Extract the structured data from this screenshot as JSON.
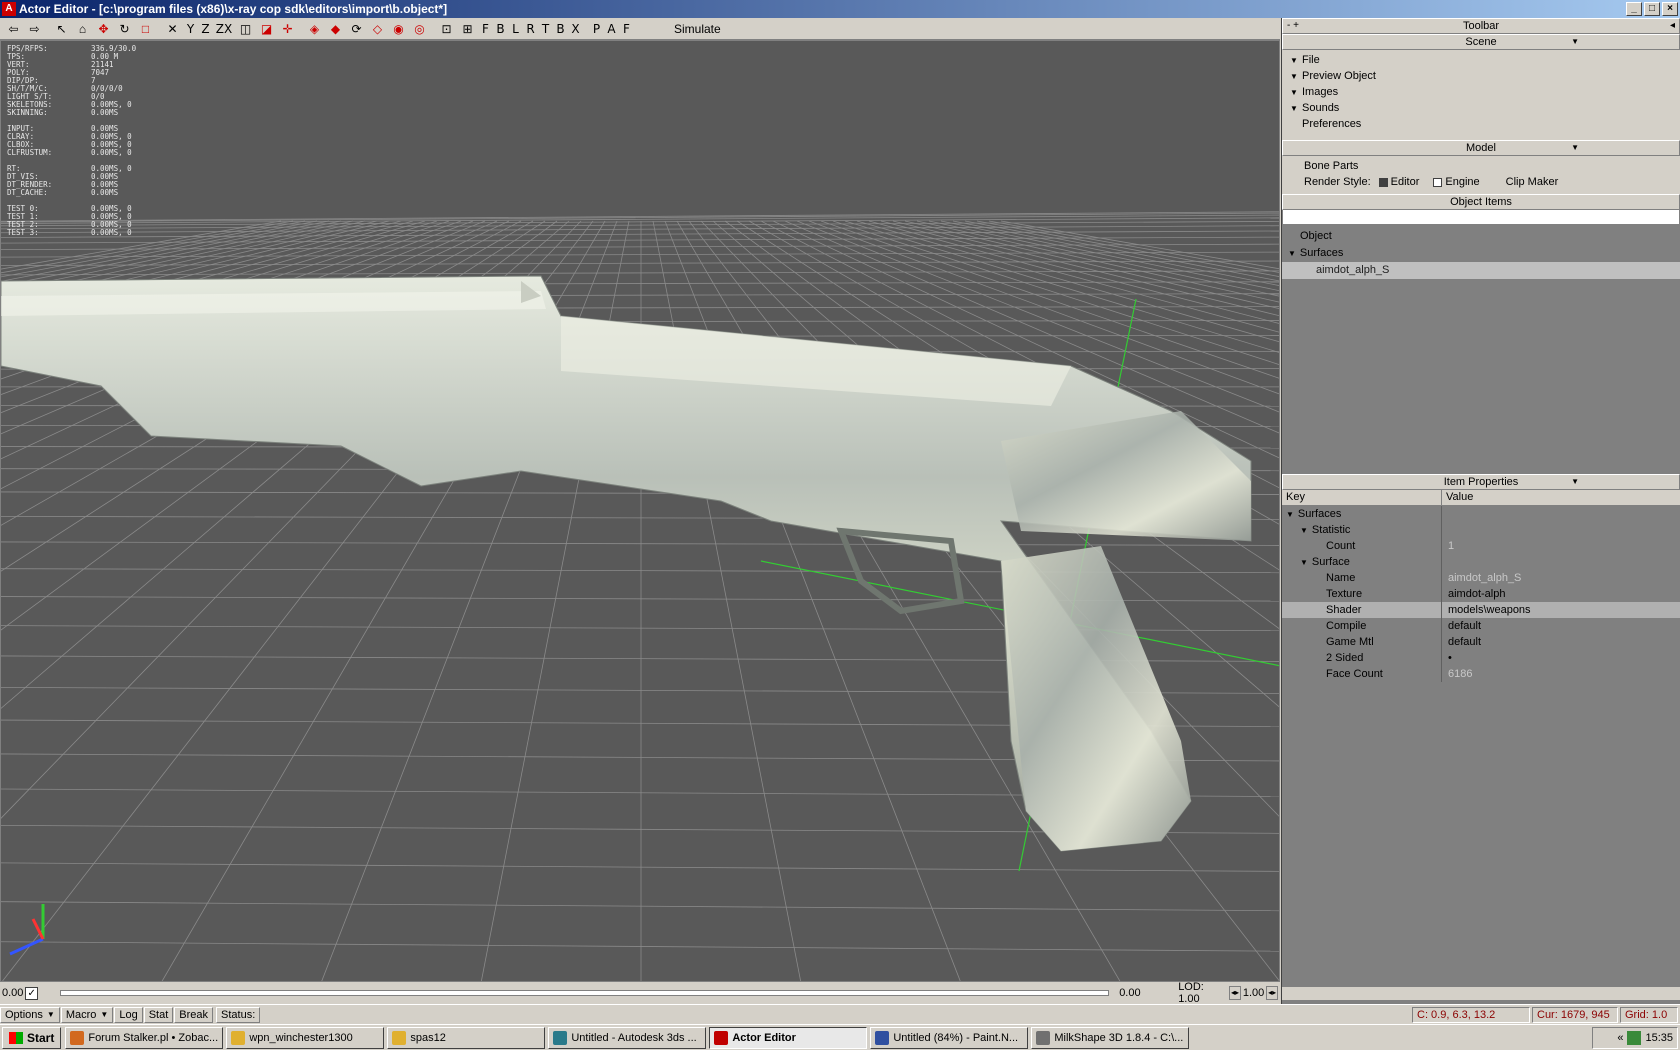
{
  "window": {
    "title": "Actor Editor - [c:\\program files (x86)\\x-ray cop sdk\\editors\\import\\b.object*]",
    "buttons": [
      "_",
      "□",
      "×"
    ]
  },
  "toolbar": {
    "letters": [
      "F",
      "B",
      "L",
      "R",
      "T",
      "B",
      "X",
      "P",
      "A",
      "F"
    ],
    "axis_labels": [
      "X",
      "Y",
      "Z",
      "ZX"
    ],
    "simulate_label": "Simulate"
  },
  "stats": [
    {
      "k": "FPS/RFPS:",
      "v": "336.9/30.0"
    },
    {
      "k": "TPS:",
      "v": "0.00 M"
    },
    {
      "k": "VERT:",
      "v": "21141"
    },
    {
      "k": "POLY:",
      "v": "7047"
    },
    {
      "k": "DIP/DP:",
      "v": "7"
    },
    {
      "k": "SH/T/M/C:",
      "v": "0/0/0/0"
    },
    {
      "k": "LIGHT S/T:",
      "v": "0/0"
    },
    {
      "k": "SKELETONS:",
      "v": "0.00MS, 0"
    },
    {
      "k": "SKINNING:",
      "v": "0.00MS"
    },
    {
      "k": "",
      "v": ""
    },
    {
      "k": "INPUT:",
      "v": "0.00MS"
    },
    {
      "k": "CLRAY:",
      "v": "0.00MS, 0"
    },
    {
      "k": "CLBOX:",
      "v": "0.00MS, 0"
    },
    {
      "k": "CLFRUSTUM:",
      "v": "0.00MS, 0"
    },
    {
      "k": "",
      "v": ""
    },
    {
      "k": " RT:",
      "v": "0.00MS, 0"
    },
    {
      "k": " DT_VIS:",
      "v": "0.00MS"
    },
    {
      "k": " DT_RENDER:",
      "v": "0.00MS"
    },
    {
      "k": " DT_CACHE:",
      "v": "0.00MS"
    },
    {
      "k": "",
      "v": ""
    },
    {
      "k": "TEST 0:",
      "v": "0.00MS, 0"
    },
    {
      "k": "TEST 1:",
      "v": "0.00MS, 0"
    },
    {
      "k": "TEST 2:",
      "v": "0.00MS, 0"
    },
    {
      "k": "TEST 3:",
      "v": "0.00MS, 0"
    }
  ],
  "timeline": {
    "left_value": "0.00",
    "checkbox": "✓",
    "right_value": "0.00",
    "lod_label": "LOD: 1.00",
    "lod_value": "1.00"
  },
  "panel": {
    "toolbar_title": "Toolbar",
    "toolbar_left": "- +",
    "toolbar_right": "◂",
    "scene_title": "Scene",
    "scene_items": [
      "File",
      "Preview Object",
      "Images",
      "Sounds",
      "Preferences"
    ],
    "model_title": "Model",
    "bone_parts": "Bone Parts",
    "render_style_label": "Render Style:",
    "render_opts": [
      "Editor",
      "Engine",
      "Clip Maker"
    ],
    "object_items_title": "Object Items",
    "object_rows": [
      "Object",
      "Surfaces",
      "aimdot_alph_S"
    ],
    "item_props_title": "Item Properties",
    "prop_headers": [
      "Key",
      "Value"
    ],
    "props": [
      {
        "k": "Surfaces",
        "v": "",
        "level": 0,
        "tri": true
      },
      {
        "k": "Statistic",
        "v": "",
        "level": 1,
        "tri": true
      },
      {
        "k": "Count",
        "v": "1",
        "level": 2,
        "dim": true
      },
      {
        "k": "Surface",
        "v": "",
        "level": 1,
        "tri": true
      },
      {
        "k": "Name",
        "v": "aimdot_alph_S",
        "level": 2,
        "dim": true
      },
      {
        "k": "Texture",
        "v": "aimdot-alph",
        "level": 2
      },
      {
        "k": "Shader",
        "v": "models\\weapons",
        "level": 2,
        "hl": true
      },
      {
        "k": "Compile",
        "v": "default",
        "level": 2
      },
      {
        "k": "Game Mtl",
        "v": "default",
        "level": 2
      },
      {
        "k": "2 Sided",
        "v": "•",
        "level": 2
      },
      {
        "k": "Face Count",
        "v": "6186",
        "level": 2,
        "dim": true
      }
    ]
  },
  "statusbar": {
    "options": "Options",
    "macro": "Macro",
    "log": "Log",
    "stat": "Stat",
    "break": "Break",
    "status": "Status:",
    "coords": "C: 0.9, 6.3, 13.2",
    "cursor": "Cur: 1679, 945",
    "grid": "Grid: 1.0"
  },
  "taskbar": {
    "start": "Start",
    "tasks": [
      {
        "label": "Forum Stalker.pl • Zobac...",
        "color": "#d2691e"
      },
      {
        "label": "wpn_winchester1300",
        "color": "#e0b030"
      },
      {
        "label": "spas12",
        "color": "#e0b030"
      },
      {
        "label": "Untitled - Autodesk 3ds ...",
        "color": "#2a7a8a"
      },
      {
        "label": "Actor Editor",
        "color": "#c00000",
        "active": true
      },
      {
        "label": "Untitled (84%) - Paint.N...",
        "color": "#3050a0"
      },
      {
        "label": "MilkShape 3D 1.8.4 - C:\\...",
        "color": "#707070"
      }
    ],
    "clock": "15:35",
    "tray_arrow": "«"
  },
  "colors": {
    "viewport_bg": "#595959",
    "grid_line": "#8a8a8a",
    "axis_green": "#33cc33",
    "title_grad_start": "#0a246a"
  }
}
